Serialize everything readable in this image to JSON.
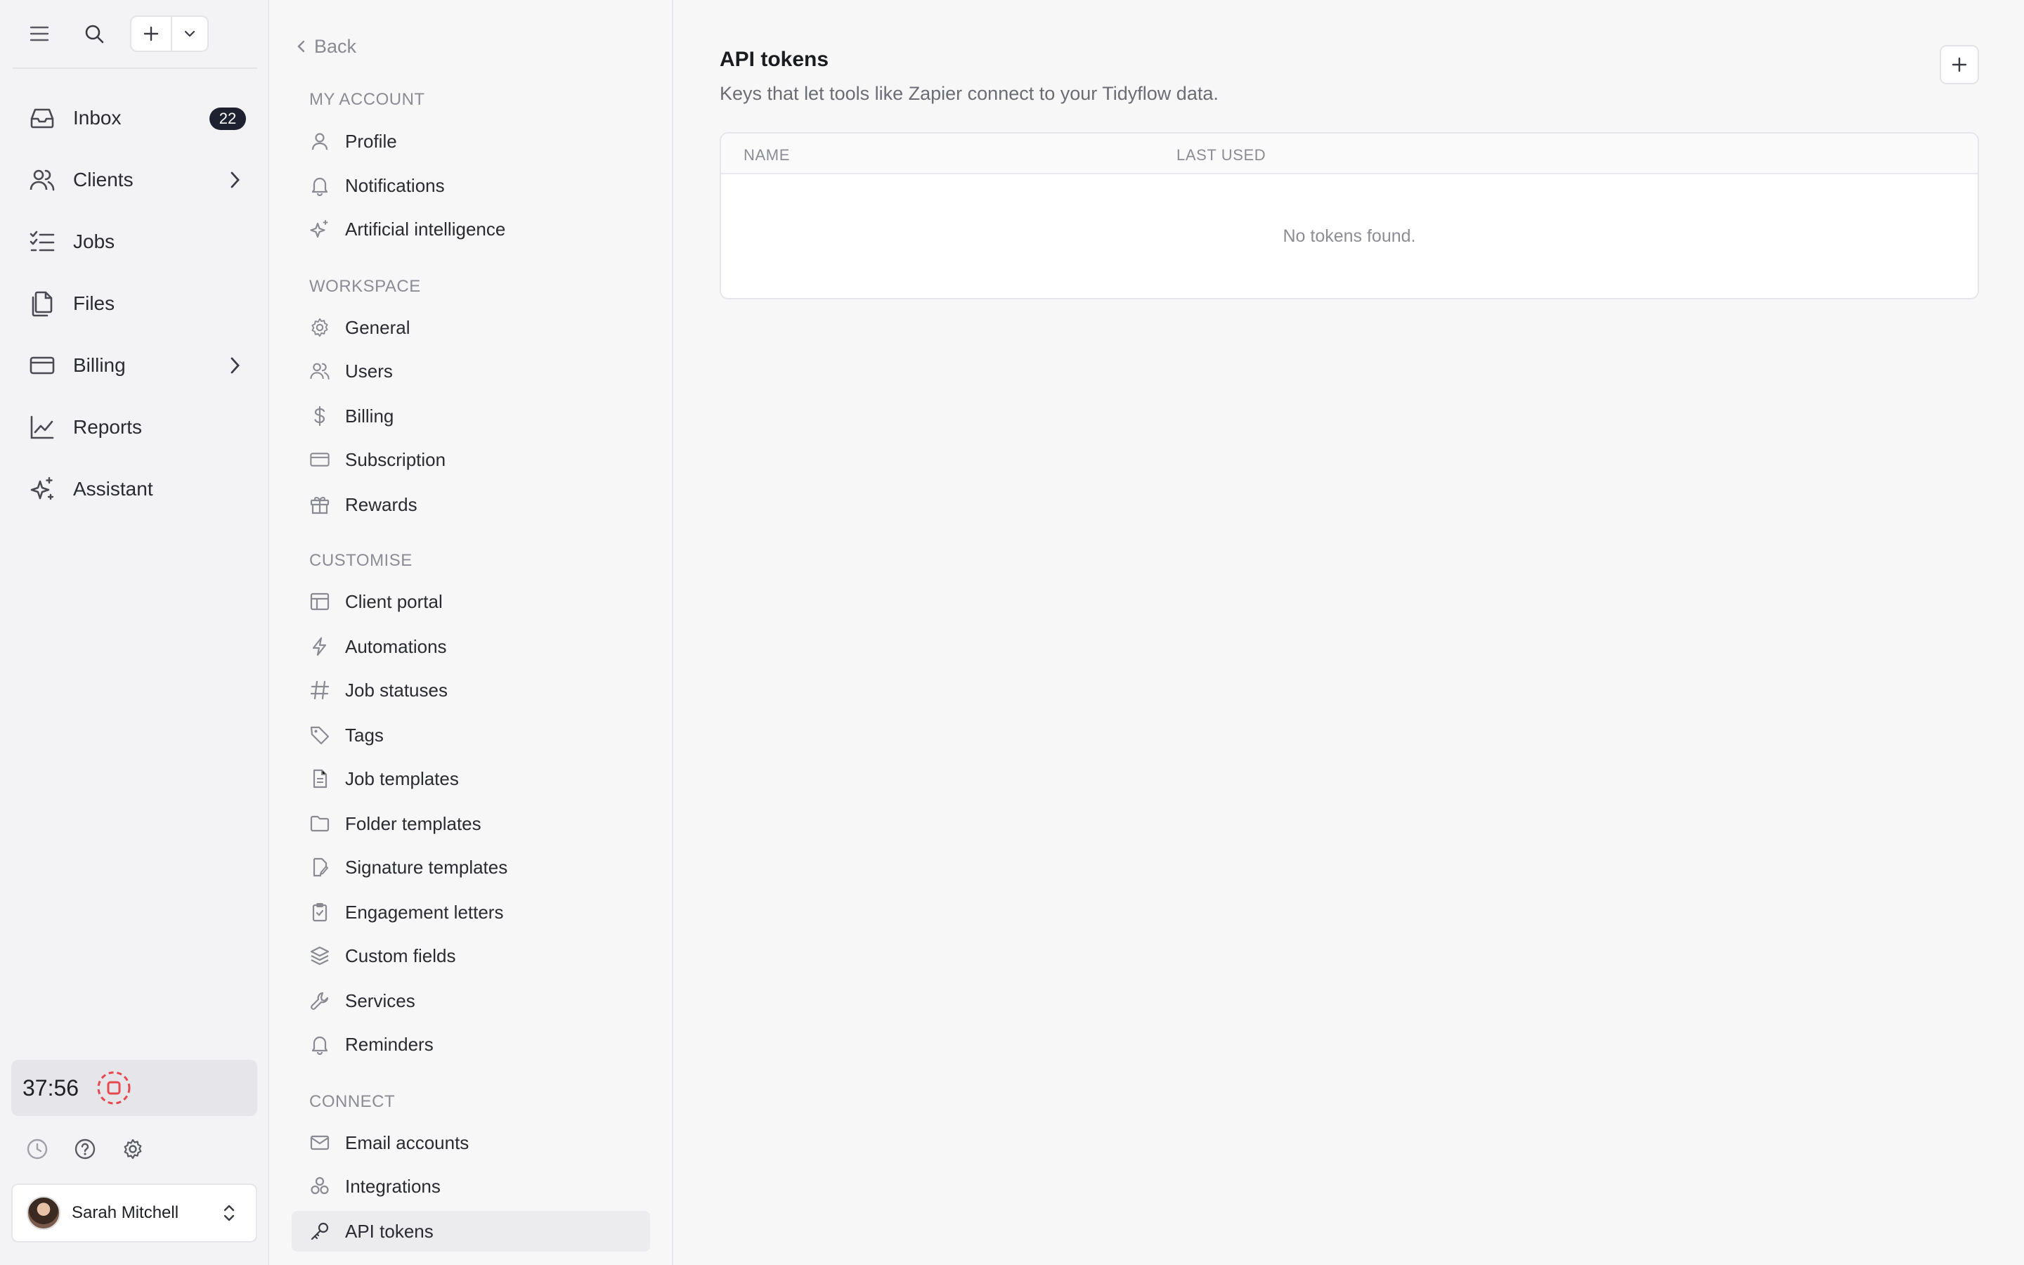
{
  "app_nav": {
    "items": [
      {
        "label": "Inbox",
        "badge": "22"
      },
      {
        "label": "Clients"
      },
      {
        "label": "Jobs"
      },
      {
        "label": "Files"
      },
      {
        "label": "Billing"
      },
      {
        "label": "Reports"
      },
      {
        "label": "Assistant"
      }
    ],
    "timer": "37:56",
    "user_name": "Sarah Mitchell"
  },
  "settings_nav": {
    "back_label": "Back",
    "groups": [
      {
        "title": "MY ACCOUNT",
        "items": [
          "Profile",
          "Notifications",
          "Artificial intelligence"
        ]
      },
      {
        "title": "WORKSPACE",
        "items": [
          "General",
          "Users",
          "Billing",
          "Subscription",
          "Rewards"
        ]
      },
      {
        "title": "CUSTOMISE",
        "items": [
          "Client portal",
          "Automations",
          "Job statuses",
          "Tags",
          "Job templates",
          "Folder templates",
          "Signature templates",
          "Engagement letters",
          "Custom fields",
          "Services",
          "Reminders"
        ]
      },
      {
        "title": "CONNECT",
        "items": [
          "Email accounts",
          "Integrations",
          "API tokens"
        ]
      }
    ],
    "active_item": "API tokens"
  },
  "main": {
    "title": "API tokens",
    "description": "Keys that let tools like Zapier connect to your Tidyflow data.",
    "table": {
      "columns": [
        "NAME",
        "LAST USED"
      ],
      "empty_message": "No tokens found."
    }
  },
  "colors": {
    "badge_bg": "#1d2130",
    "record_red": "#e5484d",
    "active_item_bg": "#ececef"
  }
}
